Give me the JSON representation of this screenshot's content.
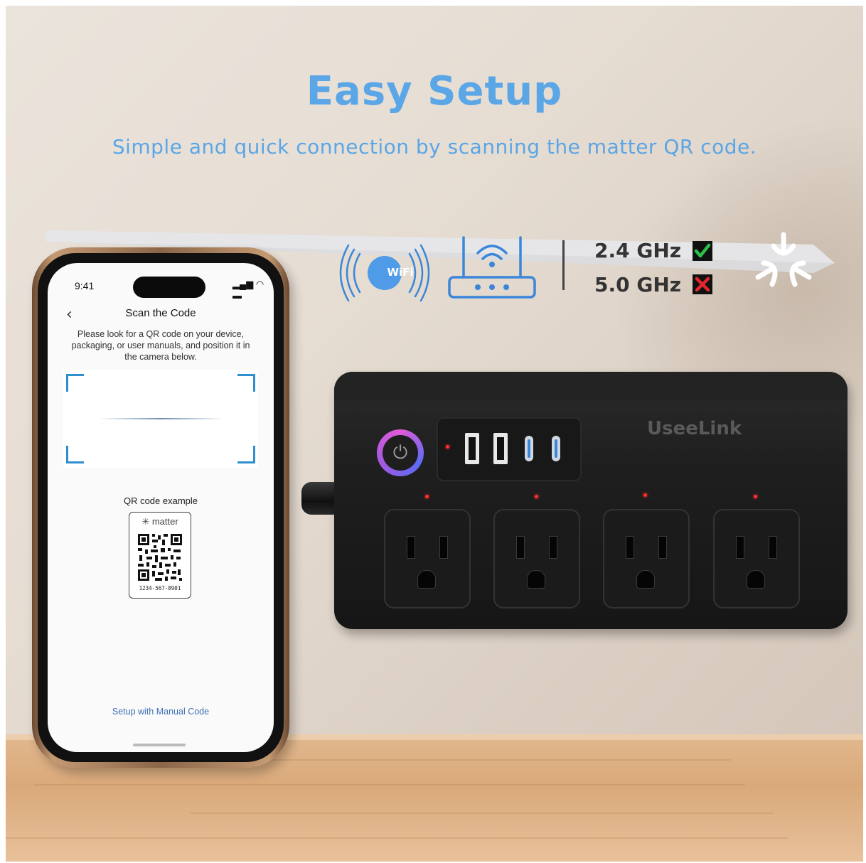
{
  "header": {
    "title": "Easy Setup",
    "subtitle": "Simple and quick connection by scanning the matter QR code."
  },
  "connectivity": {
    "wifi_badge": "WiFi",
    "bands": [
      {
        "label": "2.4 GHz",
        "supported": true
      },
      {
        "label": "5.0 GHz",
        "supported": false
      }
    ],
    "icons": [
      "wifi-signal-icon",
      "router-icon",
      "matter-logo-icon"
    ]
  },
  "phone": {
    "status_time": "9:41",
    "status_icons": "▂▄▆ ◠ ▬",
    "back_glyph": "‹",
    "screen_title": "Scan the Code",
    "description": "Please look for a QR code on your device, packaging, or user manuals, and position it in the camera below.",
    "qr_example_label": "QR code example",
    "qr_brand": "matter",
    "qr_number": "1234-567-8901",
    "manual_link": "Setup with Manual Code"
  },
  "product": {
    "brand": "UseeLink",
    "outlet_count": 4,
    "usb_ports": [
      "USB-A",
      "USB-A",
      "USB-C",
      "USB-C"
    ]
  },
  "colors": {
    "accent_blue": "#5aa6e6",
    "check_green": "#2bc24a",
    "cross_red": "#e0282c"
  }
}
